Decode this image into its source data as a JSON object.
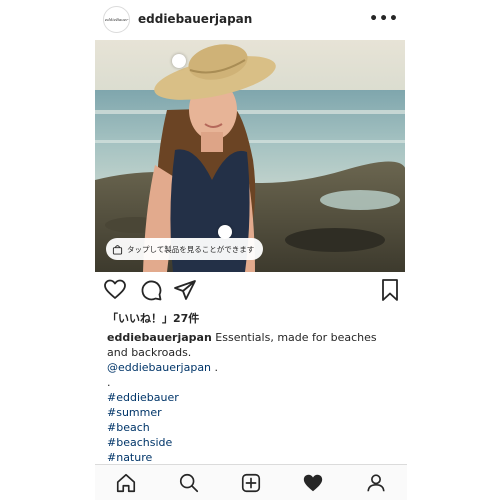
{
  "post": {
    "username": "eddiebauerjapan",
    "avatar_logo_text": "eddieBauer",
    "more_icon": "ellipsis-icon",
    "shop_prompt": "タップして製品を見ることができます",
    "likes_text": "「いいね！」27件",
    "caption_user": "eddiebauerjapan",
    "caption_text": "Essentials, made for beaches and backroads.",
    "mention": "@eddiebauerjapan",
    "mention_suffix": " .",
    "separator": ".",
    "hashtags": [
      "#eddiebauer",
      "#summer",
      "#beach",
      "#beachside",
      "#nature"
    ]
  },
  "actions": {
    "icons": [
      "heart-outline-icon",
      "comment-icon",
      "share-plane-icon",
      "bookmark-icon"
    ]
  },
  "tabbar": {
    "icons": [
      "home-icon",
      "search-icon",
      "add-post-icon",
      "activity-heart-icon",
      "profile-icon"
    ],
    "active": "activity-heart-icon"
  },
  "colors": {
    "text": "#262626",
    "link": "#003569",
    "border": "#dbdbdb",
    "tabbar_bg": "#fafafa"
  }
}
